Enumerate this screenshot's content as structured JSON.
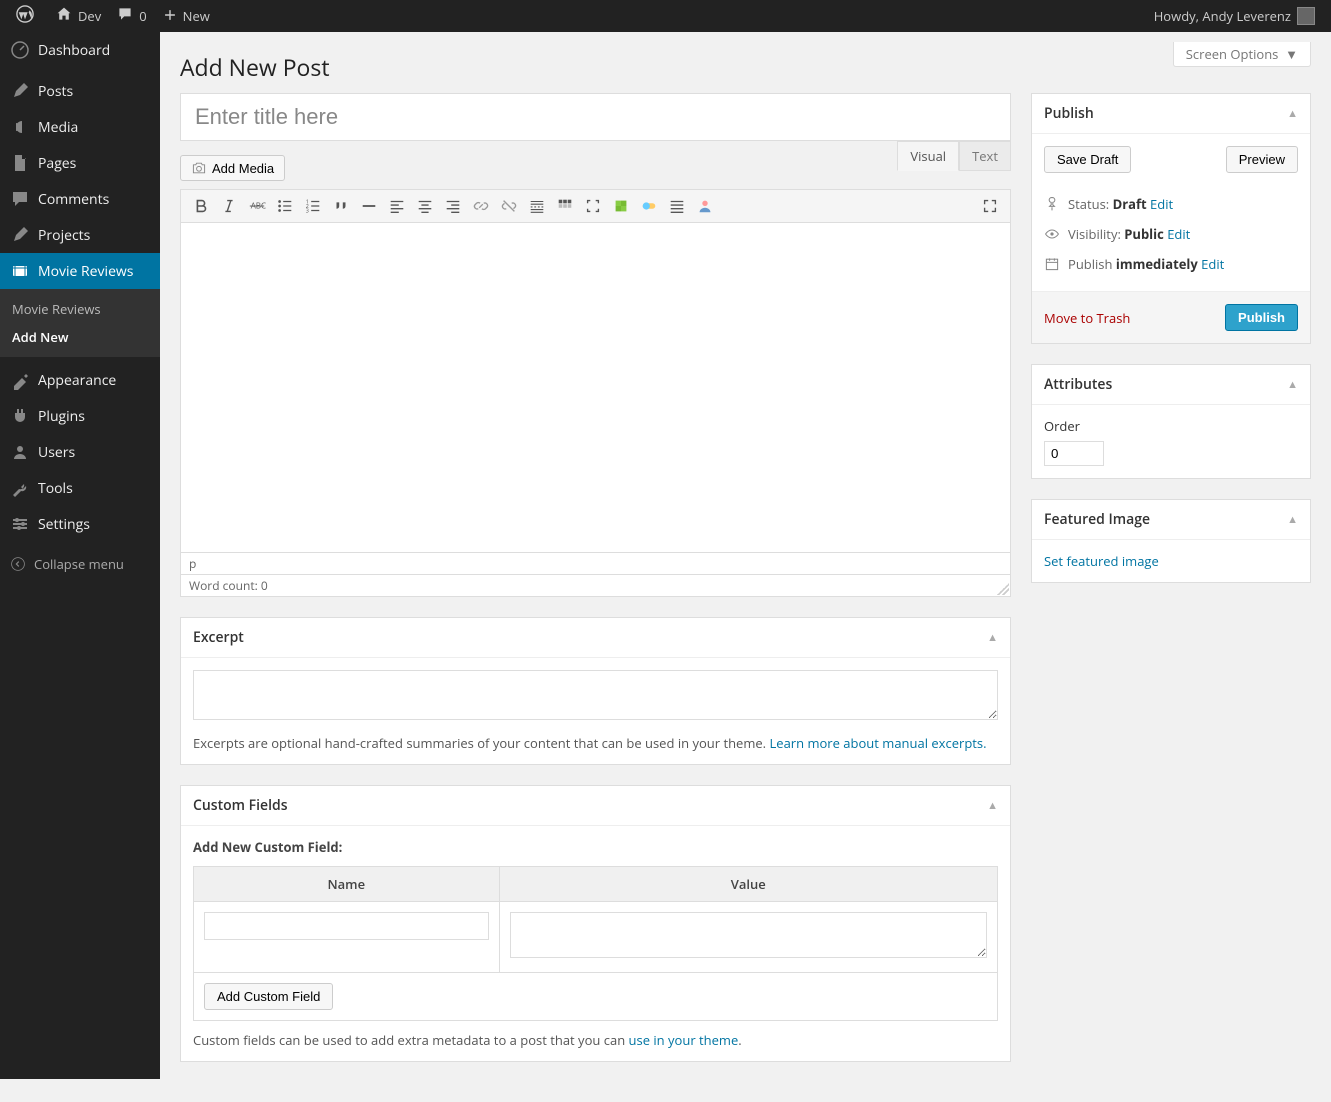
{
  "adminbar": {
    "site_name": "Dev",
    "comments_count": "0",
    "new_label": "New",
    "howdy": "Howdy, Andy Leverenz"
  },
  "sidebar": {
    "items": [
      {
        "key": "dashboard",
        "label": "Dashboard"
      },
      {
        "key": "posts",
        "label": "Posts"
      },
      {
        "key": "media",
        "label": "Media"
      },
      {
        "key": "pages",
        "label": "Pages"
      },
      {
        "key": "comments",
        "label": "Comments"
      },
      {
        "key": "projects",
        "label": "Projects"
      },
      {
        "key": "movie-reviews",
        "label": "Movie Reviews"
      },
      {
        "key": "appearance",
        "label": "Appearance"
      },
      {
        "key": "plugins",
        "label": "Plugins"
      },
      {
        "key": "users",
        "label": "Users"
      },
      {
        "key": "tools",
        "label": "Tools"
      },
      {
        "key": "settings",
        "label": "Settings"
      }
    ],
    "submenu": [
      {
        "label": "Movie Reviews",
        "current": false
      },
      {
        "label": "Add New",
        "current": true
      }
    ],
    "collapse_label": "Collapse menu"
  },
  "screen_options_label": "Screen Options",
  "page_title": "Add New Post",
  "title_placeholder": "Enter title here",
  "add_media_label": "Add Media",
  "editor": {
    "tab_visual": "Visual",
    "tab_text": "Text",
    "path": "p",
    "word_count_label": "Word count: 0"
  },
  "excerpt": {
    "box_title": "Excerpt",
    "hint_prefix": "Excerpts are optional hand-crafted summaries of your content that can be used in your theme. ",
    "hint_link": "Learn more about manual excerpts."
  },
  "custom_fields": {
    "box_title": "Custom Fields",
    "add_new_label": "Add New Custom Field:",
    "name_header": "Name",
    "value_header": "Value",
    "add_button": "Add Custom Field",
    "hint_prefix": "Custom fields can be used to add extra metadata to a post that you can ",
    "hint_link": "use in your theme"
  },
  "publish": {
    "box_title": "Publish",
    "save_draft": "Save Draft",
    "preview": "Preview",
    "status_label": "Status: ",
    "status_value": "Draft",
    "status_edit": "Edit",
    "visibility_label": "Visibility: ",
    "visibility_value": "Public",
    "visibility_edit": "Edit",
    "schedule_label": "Publish ",
    "schedule_value": "immediately",
    "schedule_edit": "Edit",
    "trash": "Move to Trash",
    "publish_btn": "Publish"
  },
  "attributes": {
    "box_title": "Attributes",
    "order_label": "Order",
    "order_value": "0"
  },
  "featured": {
    "box_title": "Featured Image",
    "set_link": "Set featured image"
  }
}
